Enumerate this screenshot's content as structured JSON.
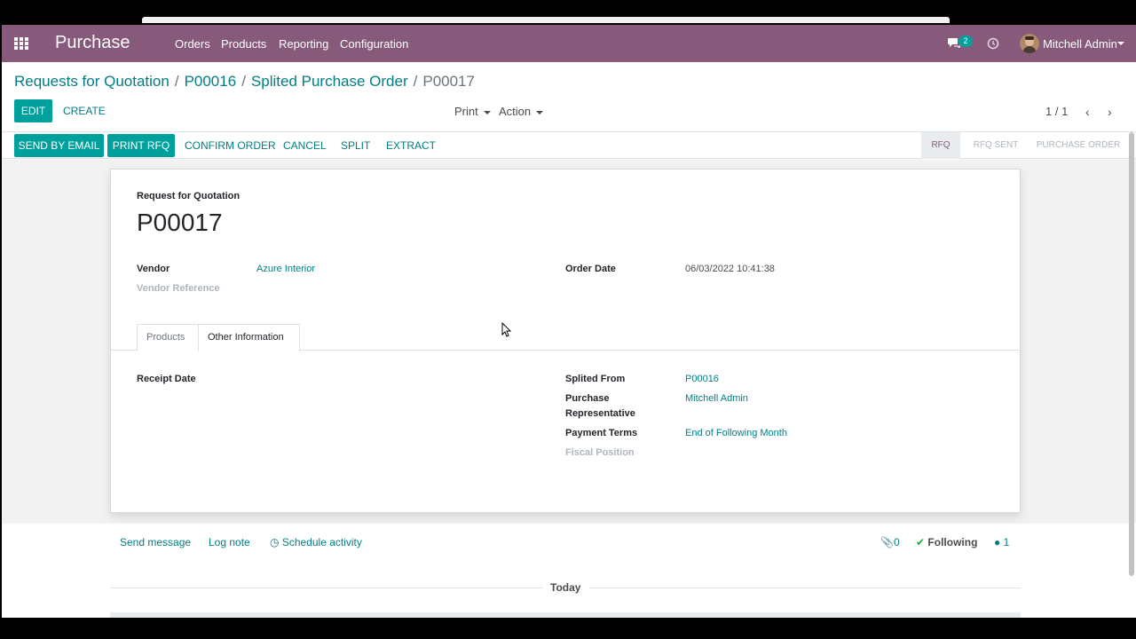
{
  "navbar": {
    "brand": "Purchase",
    "menu": [
      "Orders",
      "Products",
      "Reporting",
      "Configuration"
    ],
    "chat_count": "2",
    "user": "Mitchell Admin",
    "icons": [
      "apps-icon",
      "chat-icon",
      "clock-icon",
      "caret-down-icon"
    ]
  },
  "breadcrumb": {
    "items": [
      "Requests for Quotation",
      "P00016",
      "Splited Purchase Order"
    ],
    "current": "P00017"
  },
  "actions": {
    "edit": "EDIT",
    "create": "CREATE",
    "print": "Print",
    "action": "Action",
    "pager": "1 / 1"
  },
  "statusbar": {
    "buttons": [
      "SEND BY EMAIL",
      "PRINT RFQ",
      "CONFIRM ORDER",
      "CANCEL",
      "SPLIT",
      "EXTRACT"
    ],
    "stages": [
      "RFQ",
      "RFQ SENT",
      "PURCHASE ORDER"
    ],
    "active_stage": "RFQ"
  },
  "sheet": {
    "doc_label": "Request for Quotation",
    "doc_name": "P00017",
    "vendor_label": "Vendor",
    "vendor_value": "Azure Interior",
    "vendor_ref_label": "Vendor Reference",
    "order_date_label": "Order Date",
    "order_date_value": "06/03/2022 10:41:38",
    "tabs": [
      "Products",
      "Other Information"
    ],
    "active_tab": "Other Information",
    "receipt_date_label": "Receipt Date",
    "splited_from_label": "Splited From",
    "splited_from_value": "P00016",
    "purchase_rep_label_1": "Purchase",
    "purchase_rep_label_2": "Representative",
    "purchase_rep_value": "Mitchell Admin",
    "payment_terms_label": "Payment Terms",
    "payment_terms_value": "End of Following Month",
    "fiscal_position_label": "Fiscal Position"
  },
  "chatter": {
    "send_message": "Send message",
    "log_note": "Log note",
    "schedule_activity": "Schedule activity",
    "attachments": "0",
    "following": "Following",
    "followers": "1",
    "today": "Today"
  },
  "colors": {
    "navbar": "#875a7b",
    "primary": "#00a09d",
    "link": "#017e84"
  }
}
